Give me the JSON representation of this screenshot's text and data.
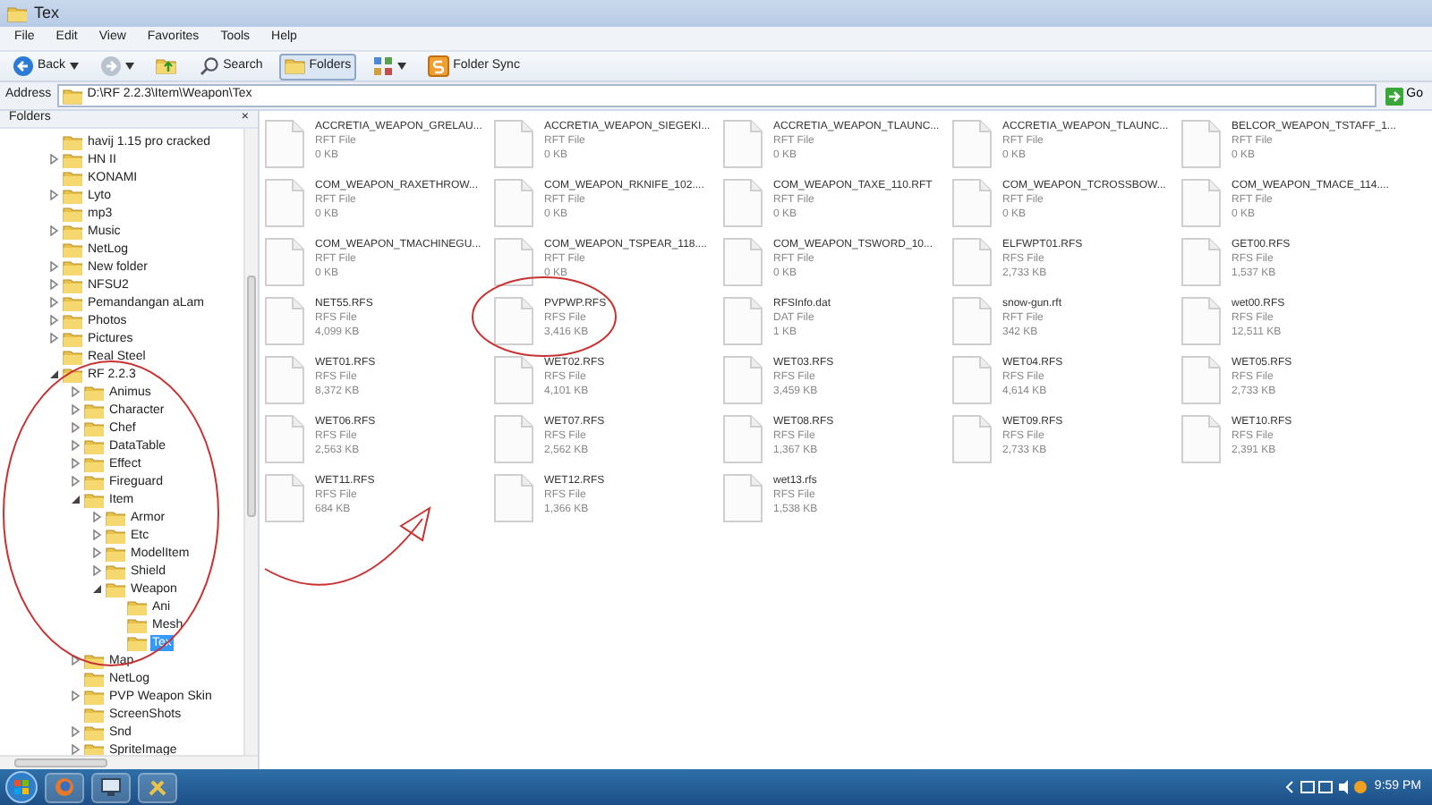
{
  "window": {
    "title": "Tex"
  },
  "menu": [
    "File",
    "Edit",
    "View",
    "Favorites",
    "Tools",
    "Help"
  ],
  "toolbar": [
    {
      "kind": "back",
      "label": "Back",
      "pressed": false
    },
    {
      "kind": "forward",
      "pressed": false
    },
    {
      "kind": "up",
      "pressed": false
    },
    {
      "kind": "search",
      "label": "Search",
      "pressed": false
    },
    {
      "kind": "folders",
      "label": "Folders",
      "pressed": true
    },
    {
      "kind": "views",
      "pressed": false
    },
    {
      "kind": "sync",
      "label": "Folder Sync",
      "pressed": false
    }
  ],
  "address": {
    "label": "Address",
    "value": "D:\\RF 2.2.3\\Item\\Weapon\\Tex",
    "go": "Go"
  },
  "folders_pane": {
    "title": "Folders",
    "close": "×"
  },
  "tree": [
    {
      "label": "havij 1.15 pro cracked",
      "kind": "leaf",
      "selected": false
    },
    {
      "label": "HN II",
      "kind": "branch",
      "expanded": false,
      "selected": false
    },
    {
      "label": "KONAMI",
      "kind": "leaf",
      "selected": false
    },
    {
      "label": "Lyto",
      "kind": "branch",
      "expanded": false,
      "selected": false
    },
    {
      "label": "mp3",
      "kind": "leaf",
      "selected": false
    },
    {
      "label": "Music",
      "kind": "branch",
      "expanded": false,
      "selected": false
    },
    {
      "label": "NetLog",
      "kind": "leaf",
      "selected": false
    },
    {
      "label": "New folder",
      "kind": "branch",
      "expanded": false,
      "selected": false
    },
    {
      "label": "NFSU2",
      "kind": "branch",
      "expanded": false,
      "selected": false
    },
    {
      "label": "Pemandangan aLam",
      "kind": "branch",
      "expanded": false,
      "selected": false
    },
    {
      "label": "Photos",
      "kind": "branch",
      "expanded": false,
      "selected": false
    },
    {
      "label": "Pictures",
      "kind": "branch",
      "expanded": false,
      "selected": false
    },
    {
      "label": "Real Steel",
      "kind": "leaf",
      "selected": false
    },
    {
      "label": "RF 2.2.3",
      "kind": "branch",
      "expanded": true,
      "selected": false,
      "children": [
        {
          "label": "Animus",
          "kind": "branch",
          "expanded": false,
          "selected": false
        },
        {
          "label": "Character",
          "kind": "branch",
          "expanded": false,
          "selected": false
        },
        {
          "label": "Chef",
          "kind": "branch",
          "expanded": false,
          "selected": false
        },
        {
          "label": "DataTable",
          "kind": "branch",
          "expanded": false,
          "selected": false
        },
        {
          "label": "Effect",
          "kind": "branch",
          "expanded": false,
          "selected": false
        },
        {
          "label": "Fireguard",
          "kind": "branch",
          "expanded": false,
          "selected": false
        },
        {
          "label": "Item",
          "kind": "branch",
          "expanded": true,
          "selected": false,
          "children": [
            {
              "label": "Armor",
              "kind": "branch",
              "expanded": false,
              "selected": false
            },
            {
              "label": "Etc",
              "kind": "branch",
              "expanded": false,
              "selected": false
            },
            {
              "label": "ModelItem",
              "kind": "branch",
              "expanded": false,
              "selected": false
            },
            {
              "label": "Shield",
              "kind": "branch",
              "expanded": false,
              "selected": false
            },
            {
              "label": "Weapon",
              "kind": "branch",
              "expanded": true,
              "selected": false,
              "children": [
                {
                  "label": "Ani",
                  "kind": "leaf",
                  "selected": false
                },
                {
                  "label": "Mesh",
                  "kind": "leaf",
                  "selected": false
                },
                {
                  "label": "Tex",
                  "kind": "leaf",
                  "selected": true
                }
              ]
            }
          ]
        },
        {
          "label": "Map",
          "kind": "branch",
          "expanded": false,
          "selected": false
        },
        {
          "label": "NetLog",
          "kind": "leaf",
          "selected": false
        },
        {
          "label": "PVP Weapon Skin",
          "kind": "branch",
          "expanded": false,
          "selected": false
        },
        {
          "label": "ScreenShots",
          "kind": "leaf",
          "selected": false
        },
        {
          "label": "Snd",
          "kind": "branch",
          "expanded": false,
          "selected": false
        },
        {
          "label": "SpriteImage",
          "kind": "branch",
          "expanded": false,
          "selected": false
        }
      ]
    }
  ],
  "files": [
    {
      "name": "ACCRETIA_WEAPON_GRELAU...",
      "type": "RFT File",
      "size": "0 KB"
    },
    {
      "name": "ACCRETIA_WEAPON_SIEGEKI...",
      "type": "RFT File",
      "size": "0 KB"
    },
    {
      "name": "ACCRETIA_WEAPON_TLAUNC...",
      "type": "RFT File",
      "size": "0 KB"
    },
    {
      "name": "ACCRETIA_WEAPON_TLAUNC...",
      "type": "RFT File",
      "size": "0 KB"
    },
    {
      "name": "BELCOR_WEAPON_TSTAFF_1...",
      "type": "RFT File",
      "size": "0 KB"
    },
    {
      "name": "COM_WEAPON_RAXETHROW...",
      "type": "RFT File",
      "size": "0 KB"
    },
    {
      "name": "COM_WEAPON_RKNIFE_102....",
      "type": "RFT File",
      "size": "0 KB"
    },
    {
      "name": "COM_WEAPON_TAXE_110.RFT",
      "type": "RFT File",
      "size": "0 KB"
    },
    {
      "name": "COM_WEAPON_TCROSSBOW...",
      "type": "RFT File",
      "size": "0 KB"
    },
    {
      "name": "COM_WEAPON_TMACE_114....",
      "type": "RFT File",
      "size": "0 KB"
    },
    {
      "name": "COM_WEAPON_TMACHINEGU...",
      "type": "RFT File",
      "size": "0 KB"
    },
    {
      "name": "COM_WEAPON_TSPEAR_118....",
      "type": "RFT File",
      "size": "0 KB"
    },
    {
      "name": "COM_WEAPON_TSWORD_10...",
      "type": "RFT File",
      "size": "0 KB"
    },
    {
      "name": "ELFWPT01.RFS",
      "type": "RFS File",
      "size": "2,733 KB"
    },
    {
      "name": "GET00.RFS",
      "type": "RFS File",
      "size": "1,537 KB"
    },
    {
      "name": "NET55.RFS",
      "type": "RFS File",
      "size": "4,099 KB"
    },
    {
      "name": "PVPWP.RFS",
      "type": "RFS File",
      "size": "3,416 KB"
    },
    {
      "name": "RFSInfo.dat",
      "type": "DAT File",
      "size": "1 KB"
    },
    {
      "name": "snow-gun.rft",
      "type": "RFT File",
      "size": "342 KB"
    },
    {
      "name": "wet00.RFS",
      "type": "RFS File",
      "size": "12,511 KB"
    },
    {
      "name": "WET01.RFS",
      "type": "RFS File",
      "size": "8,372 KB"
    },
    {
      "name": "WET02.RFS",
      "type": "RFS File",
      "size": "4,101 KB"
    },
    {
      "name": "WET03.RFS",
      "type": "RFS File",
      "size": "3,459 KB"
    },
    {
      "name": "WET04.RFS",
      "type": "RFS File",
      "size": "4,614 KB"
    },
    {
      "name": "WET05.RFS",
      "type": "RFS File",
      "size": "2,733 KB"
    },
    {
      "name": "WET06.RFS",
      "type": "RFS File",
      "size": "2,563 KB"
    },
    {
      "name": "WET07.RFS",
      "type": "RFS File",
      "size": "2,562 KB"
    },
    {
      "name": "WET08.RFS",
      "type": "RFS File",
      "size": "1,367 KB"
    },
    {
      "name": "WET09.RFS",
      "type": "RFS File",
      "size": "2,733 KB"
    },
    {
      "name": "WET10.RFS",
      "type": "RFS File",
      "size": "2,391 KB"
    },
    {
      "name": "WET11.RFS",
      "type": "RFS File",
      "size": "684 KB"
    },
    {
      "name": "WET12.RFS",
      "type": "RFS File",
      "size": "1,366 KB"
    },
    {
      "name": "wet13.rfs",
      "type": "RFS File",
      "size": "1,538 KB"
    }
  ],
  "taskbar": {
    "clock": "9:59 PM"
  }
}
